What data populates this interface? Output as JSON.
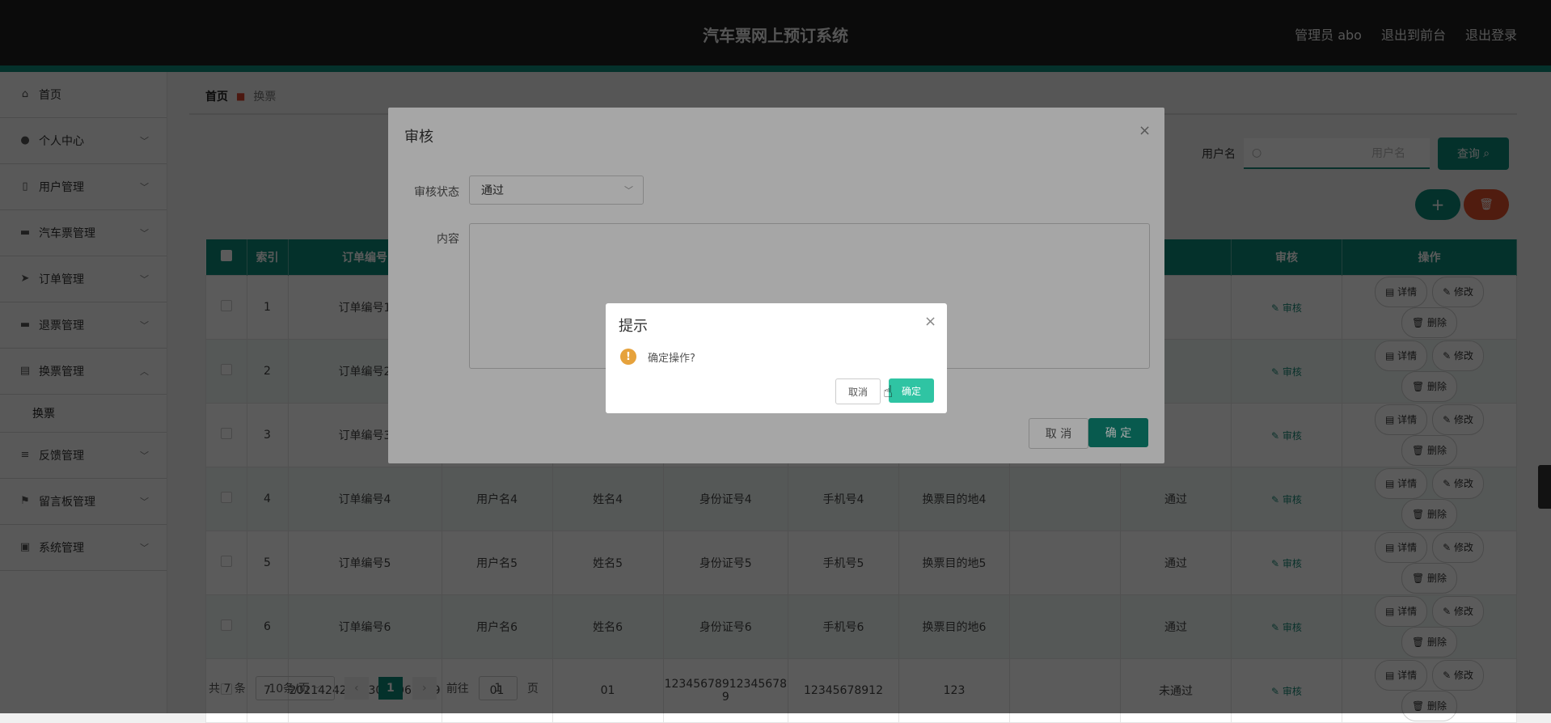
{
  "header": {
    "title": "汽车票网上预订系统",
    "links": [
      "管理员 abo",
      "退出到前台",
      "退出登录"
    ]
  },
  "sidebar": {
    "items": [
      {
        "label": "首页",
        "icon": "home-icon"
      },
      {
        "label": "个人中心",
        "icon": "user-icon"
      },
      {
        "label": "用户管理",
        "icon": "phone-icon"
      },
      {
        "label": "汽车票管理",
        "icon": "monitor-icon"
      },
      {
        "label": "订单管理",
        "icon": "send-icon"
      },
      {
        "label": "退票管理",
        "icon": "monitor-icon"
      },
      {
        "label": "换票管理",
        "icon": "clipboard-icon"
      },
      {
        "label": "反馈管理",
        "icon": "sliders-icon"
      },
      {
        "label": "留言板管理",
        "icon": "flag-icon"
      },
      {
        "label": "系统管理",
        "icon": "briefcase-icon"
      }
    ],
    "submenu": "换票"
  },
  "breadcrumb": {
    "home": "首页",
    "current": "换票"
  },
  "search": {
    "label": "用户名",
    "placeholder": "用户名",
    "button": "查询"
  },
  "table": {
    "headers": [
      "索引",
      "订单编号",
      "审核",
      "操作"
    ],
    "rows": [
      {
        "idx": "1",
        "order": "订单编号1",
        "user": "",
        "name": "",
        "idcard": "",
        "phone": "",
        "dest": "",
        "status": ""
      },
      {
        "idx": "2",
        "order": "订单编号2",
        "user": "",
        "name": "",
        "idcard": "",
        "phone": "",
        "dest": "",
        "status": ""
      },
      {
        "idx": "3",
        "order": "订单编号3",
        "user": "",
        "name": "",
        "idcard": "",
        "phone": "",
        "dest": "",
        "status": ""
      },
      {
        "idx": "4",
        "order": "订单编号4",
        "user": "用户名4",
        "name": "姓名4",
        "idcard": "身份证号4",
        "phone": "手机号4",
        "dest": "换票目的地4",
        "status": "通过"
      },
      {
        "idx": "5",
        "order": "订单编号5",
        "user": "用户名5",
        "name": "姓名5",
        "idcard": "身份证号5",
        "phone": "手机号5",
        "dest": "换票目的地5",
        "status": "通过"
      },
      {
        "idx": "6",
        "order": "订单编号6",
        "user": "用户名6",
        "name": "姓名6",
        "idcard": "身份证号6",
        "phone": "手机号6",
        "dest": "换票目的地6",
        "status": "通过"
      },
      {
        "idx": "7",
        "order": "202142423173076961399",
        "user": "01",
        "name": "01",
        "idcard": "12345678912345678 9",
        "phone": "12345678912",
        "dest": "123",
        "status": "未通过"
      }
    ],
    "audit_label": "审核",
    "detail_label": "详情",
    "edit_label": "修改",
    "delete_label": "删除"
  },
  "pager": {
    "total": "共 7 条",
    "size": "10条/页",
    "page": "1",
    "goto_prefix": "前往",
    "goto_value": "1",
    "goto_suffix": "页"
  },
  "audit_dialog": {
    "title": "审核",
    "status_label": "审核状态",
    "status_value": "通过",
    "content_label": "内容",
    "cancel": "取 消",
    "ok": "确 定"
  },
  "confirm_box": {
    "title": "提示",
    "message": "确定操作?",
    "cancel": "取消",
    "ok": "确定"
  },
  "colors": {
    "accent": "#0d8b79",
    "danger": "#e0502a",
    "warning": "#e6a23c"
  }
}
